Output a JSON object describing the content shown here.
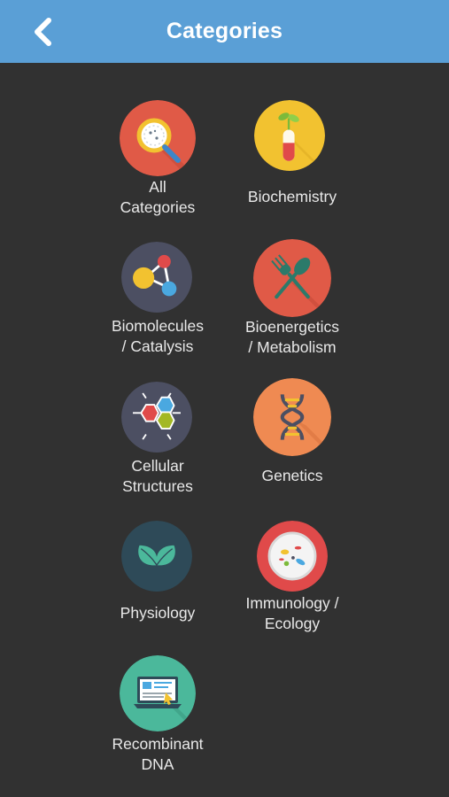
{
  "header": {
    "title": "Categories"
  },
  "icons": {
    "back": "chevron-left-icon"
  },
  "categories": [
    {
      "line1": "All",
      "line2": "Categories",
      "icon": "magnifier-icon",
      "color": "#e05a47"
    },
    {
      "line1": "Biochemistry",
      "line2": "",
      "icon": "test-tube-sprout-icon",
      "color": "#f2c230"
    },
    {
      "line1": "Biomolecules",
      "line2": "/ Catalysis",
      "icon": "molecule-icon",
      "color": "#4c4f62"
    },
    {
      "line1": "Bioenergetics",
      "line2": "/ Metabolism",
      "icon": "fork-knife-icon",
      "color": "#e05a47"
    },
    {
      "line1": "Cellular",
      "line2": "Structures",
      "icon": "hexagon-cells-icon",
      "color": "#4c4f62"
    },
    {
      "line1": "Genetics",
      "line2": "",
      "icon": "dna-icon",
      "color": "#ef8a52"
    },
    {
      "line1": "Physiology",
      "line2": "",
      "icon": "leaves-icon",
      "color": "#2e4a58"
    },
    {
      "line1": "Immunology /",
      "line2": "Ecology",
      "icon": "petri-dish-icon",
      "color": "#e04a4a"
    },
    {
      "line1": "Recombinant",
      "line2": "DNA",
      "icon": "laptop-icon",
      "color": "#4bb89b"
    }
  ]
}
